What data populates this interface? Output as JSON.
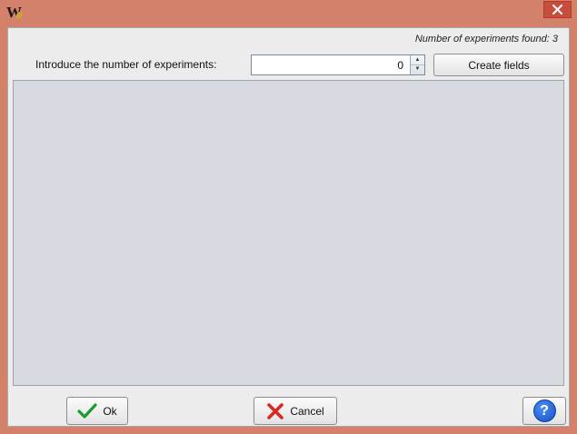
{
  "window": {
    "app_icon_letter": "W",
    "close_symbol": "×"
  },
  "header": {
    "experiments_found": "Number of experiments found: 3",
    "intro_label": "Introduce the number of experiments:"
  },
  "spinner": {
    "value": "0",
    "up_symbol": "▲",
    "down_symbol": "▼"
  },
  "buttons": {
    "create_fields": "Create fields",
    "ok": "Ok",
    "cancel": "Cancel",
    "help": "?"
  },
  "icons": {
    "app": "app-logo-icon",
    "close": "close-icon",
    "ok": "checkmark-icon",
    "cancel": "cross-icon",
    "help": "help-icon"
  },
  "colors": {
    "window_frame": "#d3816a",
    "close_button": "#c74e3d",
    "panel_background": "#d7dae0",
    "ok_check": "#1e9a2a",
    "cancel_cross": "#d42a1f",
    "help_blue": "#1f62d8"
  }
}
